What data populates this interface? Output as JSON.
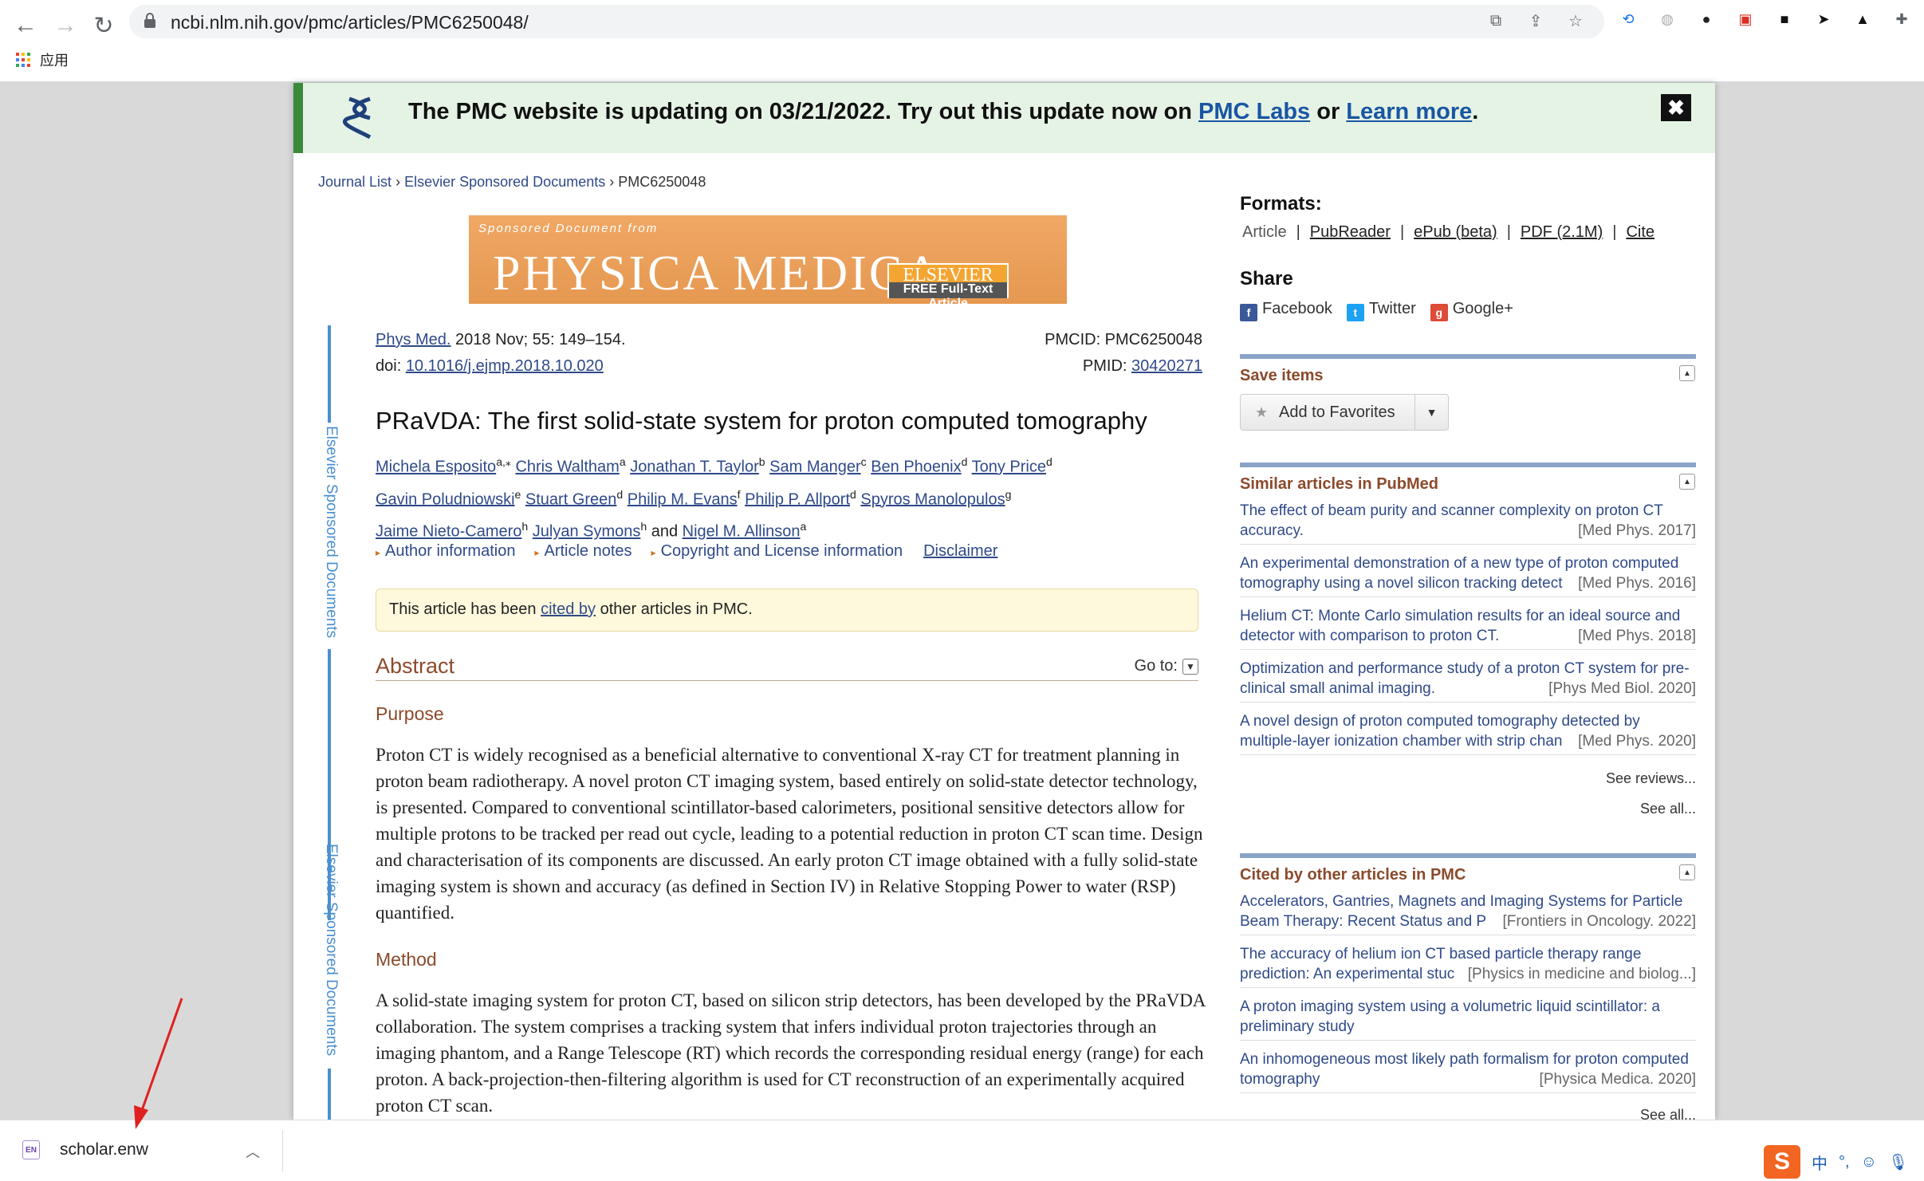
{
  "browser": {
    "url": "ncbi.nlm.nih.gov/pmc/articles/PMC6250048/",
    "bookmarks_apps": "应用"
  },
  "banner": {
    "text_before": "The PMC website is updating on 03/21/2022. Try out this update now on ",
    "link1": "PMC Labs",
    "text_mid": " or ",
    "link2": "Learn more",
    "text_end": ".",
    "close": "✖"
  },
  "breadcrumb": {
    "items": [
      "Journal List",
      "Elsevier Sponsored Documents",
      "PMC6250048"
    ],
    "sep": "›"
  },
  "journal_banner": {
    "small": "Sponsored Document from",
    "big": "PHYSICA MEDICA",
    "els1": "ELSEVIER",
    "els2": "FREE Full-Text Article"
  },
  "side_label": "Elsevier Sponsored Documents",
  "citation": {
    "journal": "Phys Med.",
    "date": " 2018 Nov; 55: 149–154.",
    "doi_label": "doi: ",
    "doi": "10.1016/j.ejmp.2018.10.020",
    "pmcid": "PMCID: PMC6250048",
    "pmid_label": "PMID: ",
    "pmid": "30420271"
  },
  "title": "PRaVDA: The first solid-state system for proton computed tomography",
  "authors": [
    {
      "name": "Michela Esposito",
      "sup": "a,⁎"
    },
    {
      "name": "Chris Waltham",
      "sup": "a"
    },
    {
      "name": "Jonathan T. Taylor",
      "sup": "b"
    },
    {
      "name": "Sam Manger",
      "sup": "c"
    },
    {
      "name": "Ben Phoenix",
      "sup": "d"
    },
    {
      "name": "Tony Price",
      "sup": "d"
    },
    {
      "name": "Gavin Poludniowski",
      "sup": "e"
    },
    {
      "name": "Stuart Green",
      "sup": "d"
    },
    {
      "name": "Philip M. Evans",
      "sup": "f"
    },
    {
      "name": "Philip P. Allport",
      "sup": "d"
    },
    {
      "name": "Spyros Manolopulos",
      "sup": "g"
    },
    {
      "name": "Jaime Nieto-Camero",
      "sup": "h"
    },
    {
      "name": "Julyan Symons",
      "sup": "h"
    },
    {
      "name": "Nigel M. Allinson",
      "sup": "a"
    }
  ],
  "authors_and": "and",
  "meta_links": {
    "author_info": "Author information",
    "article_notes": "Article notes",
    "copyright": "Copyright and License information",
    "disclaimer": "Disclaimer"
  },
  "cited_box": {
    "before": "This article has been ",
    "link": "cited by",
    "after": " other articles in PMC."
  },
  "abstract": {
    "heading": "Abstract",
    "goto": "Go to:",
    "purpose_h": "Purpose",
    "purpose": "Proton CT is widely recognised as a beneficial alternative to conventional X-ray CT for treatment planning in proton beam radiotherapy. A novel proton CT imaging system, based entirely on solid-state detector technology, is presented. Compared to conventional scintillator-based calorimeters, positional sensitive detectors allow for multiple protons to be tracked per read out cycle, leading to a potential reduction in proton CT scan time. Design and characterisation of its components are discussed. An early proton CT image obtained with a fully solid-state imaging system is shown and accuracy (as defined in Section IV) in Relative Stopping Power to water (RSP) quantified.",
    "method_h": "Method",
    "method": "A solid-state imaging system for proton CT, based on silicon strip detectors, has been developed by the PRaVDA collaboration. The system comprises a tracking system that infers individual proton trajectories through an imaging phantom, and a Range Telescope (RT) which records the corresponding residual energy (range) for each proton. A back-projection-then-filtering algorithm is used for CT reconstruction of an experimentally acquired proton CT scan."
  },
  "formats": {
    "heading": "Formats:",
    "article": "Article",
    "pubreader": "PubReader",
    "epub": "ePub (beta)",
    "pdf": "PDF (2.1M)",
    "cite": "Cite",
    "sep": "|"
  },
  "share": {
    "heading": "Share",
    "facebook": "Facebook",
    "twitter": "Twitter",
    "google": "Google+"
  },
  "save_items": {
    "heading": "Save items",
    "add": "Add to Favorites"
  },
  "similar": {
    "heading": "Similar articles in PubMed",
    "items": [
      {
        "title": "The effect of beam purity and scanner complexity on proton CT accuracy.",
        "src": "[Med Phys. 2017]"
      },
      {
        "title": "An experimental demonstration of a new type of proton computed tomography using a novel silicon tracking detect",
        "src": "[Med Phys. 2016]"
      },
      {
        "title": "Helium CT: Monte Carlo simulation results for an ideal source and detector with comparison to proton CT.",
        "src": "[Med Phys. 2018]"
      },
      {
        "title": "Optimization and performance study of a proton CT system for pre-clinical small animal imaging.",
        "src": "[Phys Med Biol. 2020]"
      },
      {
        "title": "A novel design of proton computed tomography detected by multiple-layer ionization chamber with strip chan",
        "src": "[Med Phys. 2020]"
      }
    ],
    "see_reviews": "See reviews...",
    "see_all": "See all..."
  },
  "cited_by": {
    "heading": "Cited by other articles in PMC",
    "items": [
      {
        "title": "Accelerators, Gantries, Magnets and Imaging Systems for Particle Beam Therapy: Recent Status and P",
        "src": "[Frontiers in Oncology. 2022]"
      },
      {
        "title": "The accuracy of helium ion CT based particle therapy range prediction: An experimental stuc",
        "src": "[Physics in medicine and biolog...]"
      },
      {
        "title": "A proton imaging system using a volumetric liquid scintillator: a preliminary study",
        "src": ""
      },
      {
        "title": "An inhomogeneous most likely path formalism for proton computed tomography",
        "src": "[Physica Medica. 2020]"
      }
    ],
    "see_all": "See all..."
  },
  "download": {
    "icon": "EN",
    "filename": "scholar.enw"
  },
  "ime": {
    "logo": "S",
    "lang": "中",
    "punct": "°,"
  },
  "colors": {
    "link": "#2f4a8a",
    "section_heading": "#8b4a2b",
    "banner_bg": "#e5f3e5",
    "banner_accent": "#3a8a3a"
  }
}
